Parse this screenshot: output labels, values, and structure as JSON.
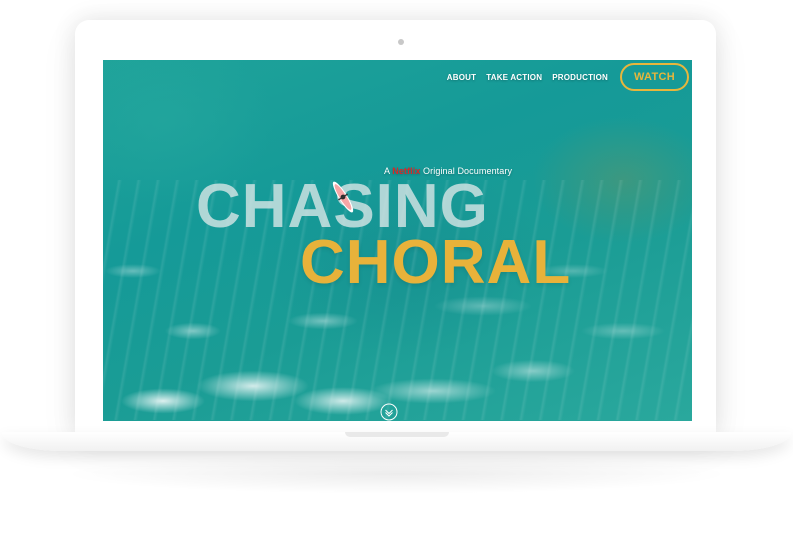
{
  "nav": {
    "links": [
      "ABOUT",
      "TAKE ACTION",
      "PRODUCTION"
    ],
    "watch_label": "WATCH"
  },
  "hero": {
    "tagline_prefix": "A ",
    "tagline_brand": "Netflix",
    "tagline_suffix": " Original Documentary",
    "title_line1": "CHASING",
    "title_line2": "CHORAL"
  },
  "colors": {
    "accent": "#e8b23a",
    "brand": "#d42b2b",
    "ocean": "#159a98"
  },
  "icons": {
    "scroll": "chevron-down-circle-icon",
    "kayak": "kayak-icon"
  }
}
